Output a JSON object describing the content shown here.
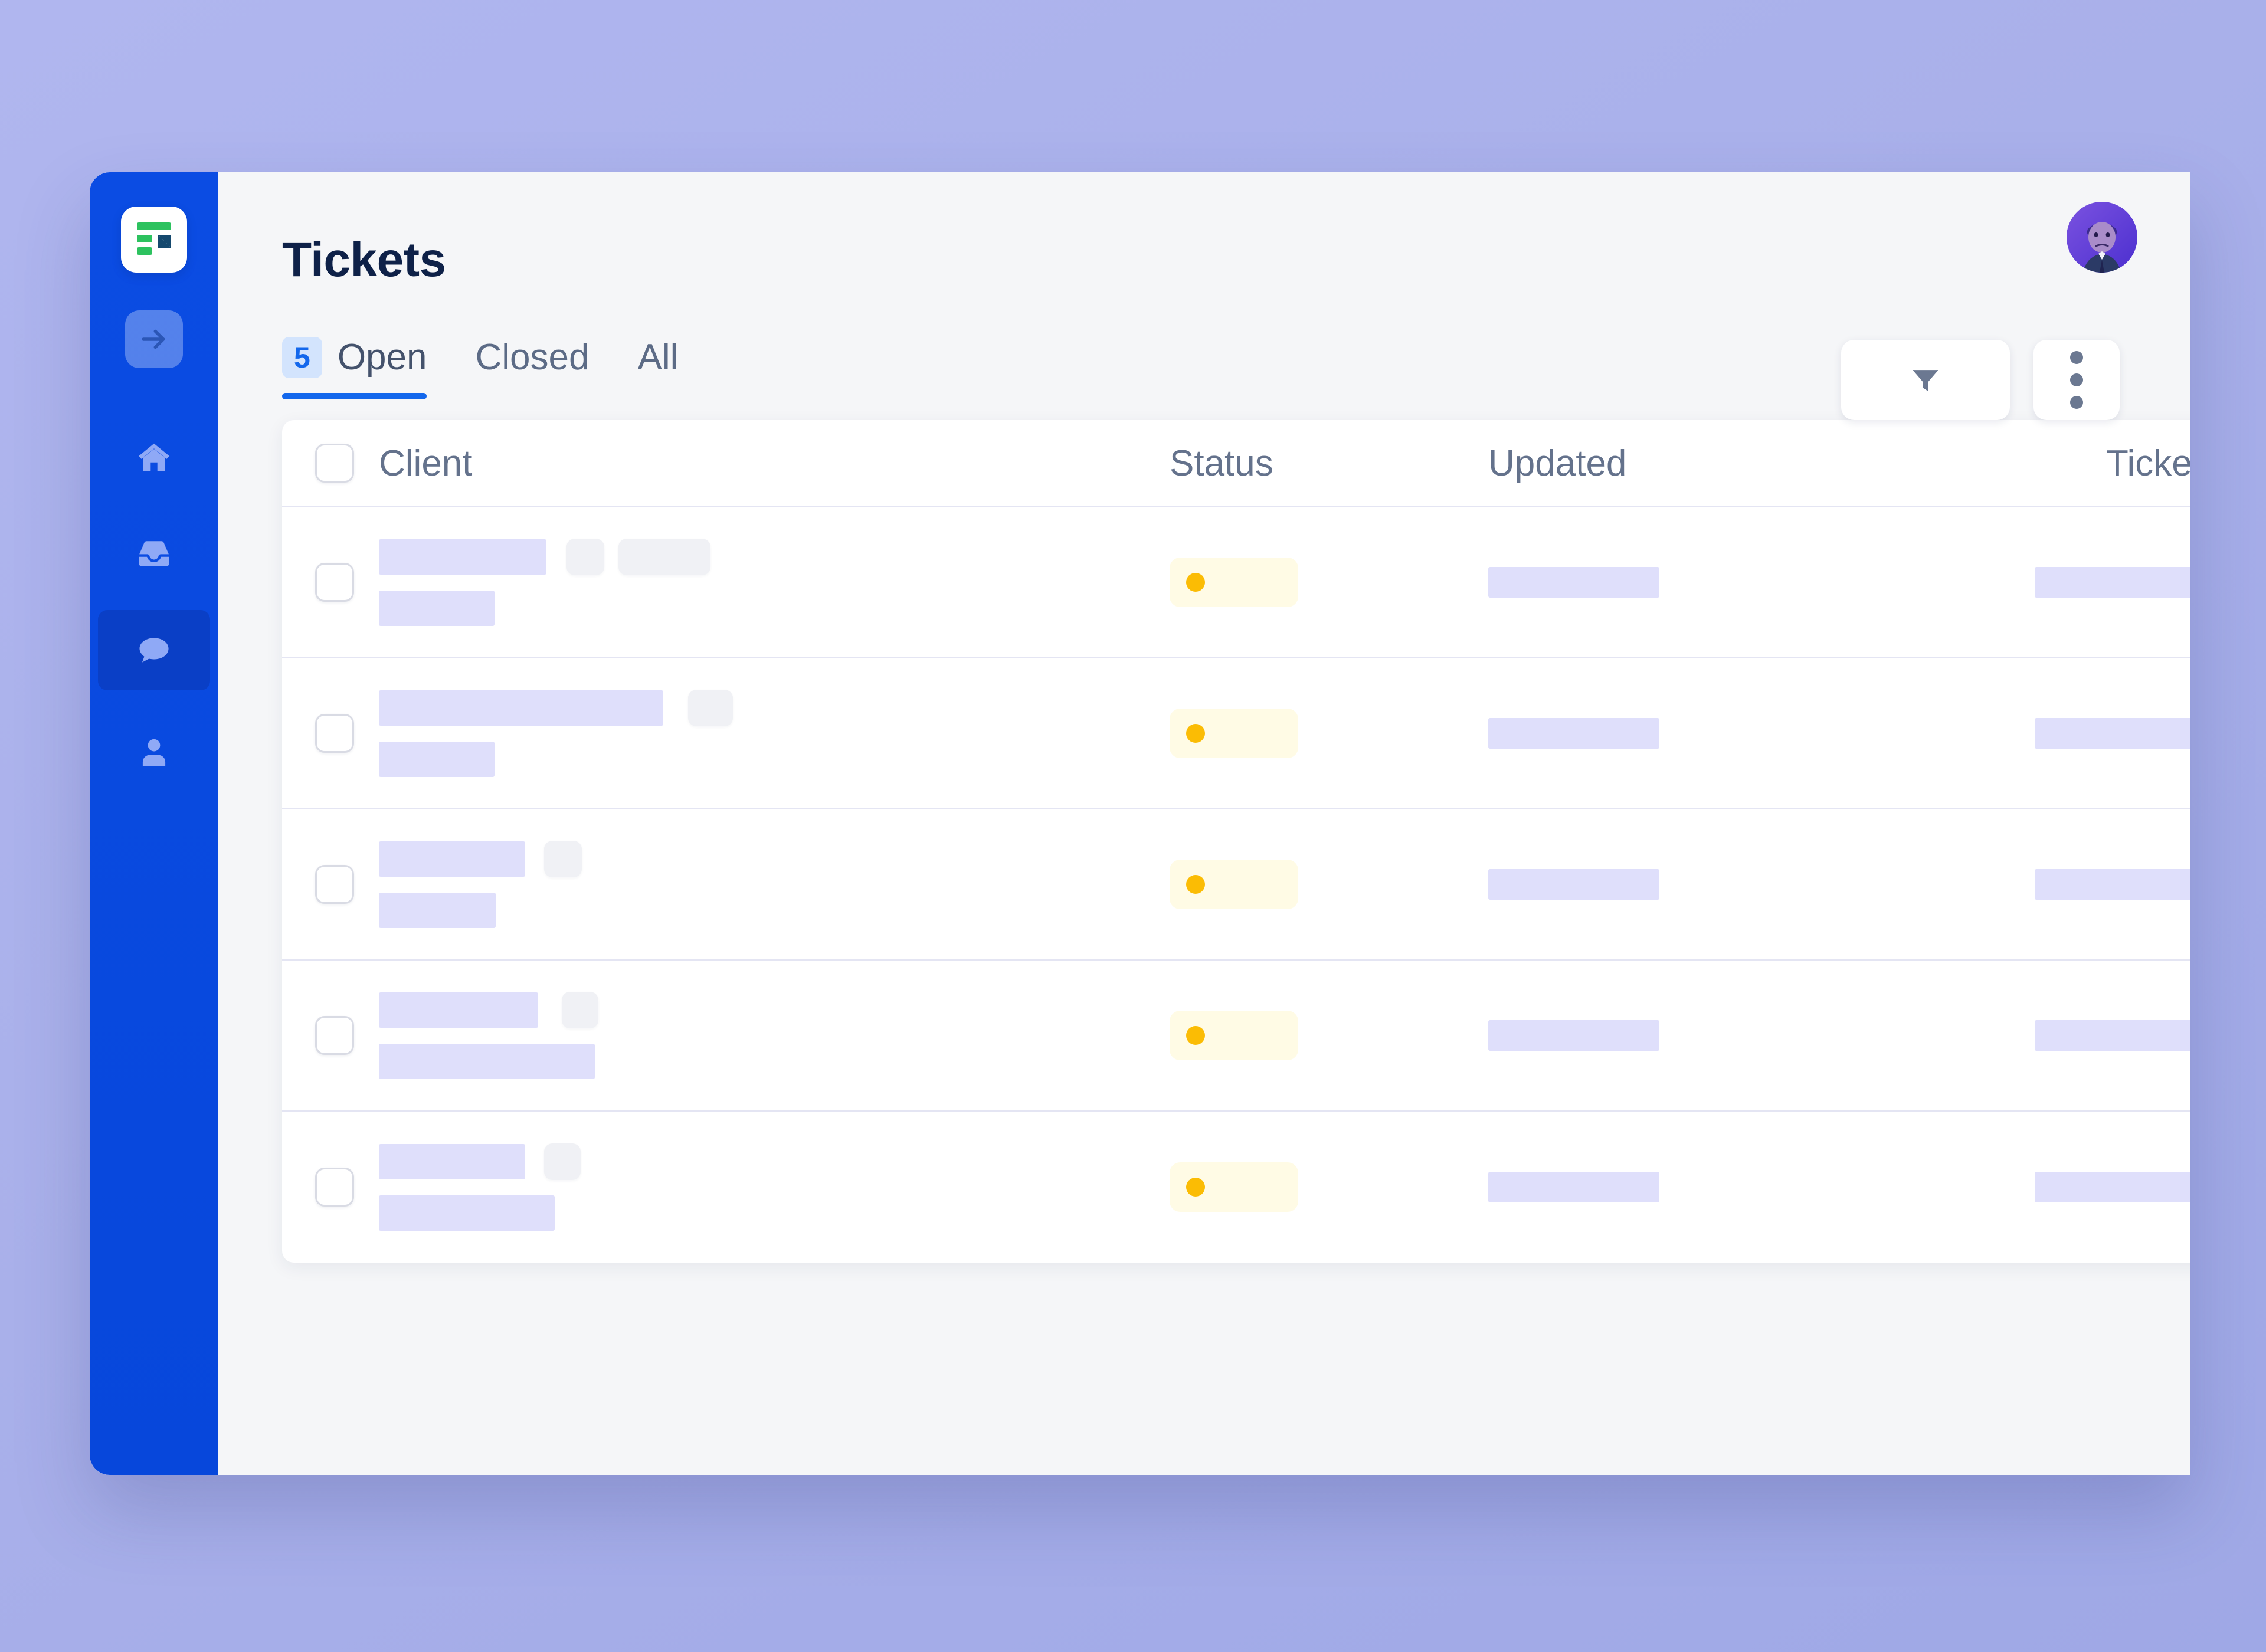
{
  "theme": {
    "page_background": "#a9b0ea",
    "sidebar_color": "#0a4de0",
    "sidebar_active_color": "#0a3fc6",
    "accent_color": "#1367ec",
    "title_color": "#0e2148",
    "muted_text_color": "#5c6b86",
    "card_background": "#ffffff",
    "app_background": "#f5f6f8",
    "skeleton_lavender": "#dfdffb",
    "skeleton_gray": "#f0f1f5",
    "status_pill_background": "#fffbe5",
    "status_dot_color": "#fbbc04",
    "badge_background": "#d3e4fd",
    "logo_green": "#2dc25f",
    "logo_navy": "#15496e"
  },
  "sidebar": {
    "logo": {
      "name": "app-logo",
      "icon": "document-list-logo"
    },
    "items": [
      {
        "name": "sidebar-item-expand",
        "icon": "arrow-right-icon",
        "active": false,
        "boxed": true
      },
      {
        "name": "sidebar-item-home",
        "icon": "home-icon",
        "active": false,
        "boxed": false
      },
      {
        "name": "sidebar-item-inbox",
        "icon": "inbox-icon",
        "active": false,
        "boxed": false
      },
      {
        "name": "sidebar-item-messages",
        "icon": "chat-bubble-icon",
        "active": true,
        "boxed": false
      },
      {
        "name": "sidebar-item-contacts",
        "icon": "person-icon",
        "active": false,
        "boxed": false
      }
    ]
  },
  "header": {
    "title": "Tickets",
    "avatar": {
      "name": "user-avatar",
      "icon": "user-photo-avatar"
    }
  },
  "tabs": [
    {
      "label": "Open",
      "badge": "5",
      "active": true
    },
    {
      "label": "Closed",
      "badge": null,
      "active": false
    },
    {
      "label": "All",
      "badge": null,
      "active": false
    }
  ],
  "toolbar": {
    "filter_button": {
      "label": "",
      "icon": "funnel-filter-icon"
    },
    "more_button": {
      "label": "",
      "icon": "more-vertical-icon"
    }
  },
  "table": {
    "columns": [
      {
        "key": "select",
        "label": ""
      },
      {
        "key": "client",
        "label": "Client"
      },
      {
        "key": "status",
        "label": "Status"
      },
      {
        "key": "updated",
        "label": "Updated"
      },
      {
        "key": "ticket",
        "label": "Ticket"
      }
    ],
    "rows": [
      {
        "client_primary_width": 284,
        "client_chips": [
          64,
          156
        ],
        "client_secondary_width": 196,
        "status": {
          "dot_color": "#fbbc04",
          "label": ""
        },
        "updated_width": 290,
        "ticket_width": 284
      },
      {
        "client_primary_width": 482,
        "client_chips": [
          76
        ],
        "client_secondary_width": 196,
        "status": {
          "dot_color": "#fbbc04",
          "label": ""
        },
        "updated_width": 290,
        "ticket_width": 284
      },
      {
        "client_primary_width": 248,
        "client_chips": [
          64
        ],
        "client_secondary_width": 198,
        "status": {
          "dot_color": "#fbbc04",
          "label": ""
        },
        "updated_width": 290,
        "ticket_width": 284
      },
      {
        "client_primary_width": 270,
        "client_chips": [
          62
        ],
        "client_secondary_width": 366,
        "status": {
          "dot_color": "#fbbc04",
          "label": ""
        },
        "updated_width": 290,
        "ticket_width": 284
      },
      {
        "client_primary_width": 248,
        "client_chips": [
          62
        ],
        "client_secondary_width": 298,
        "status": {
          "dot_color": "#fbbc04",
          "label": ""
        },
        "updated_width": 290,
        "ticket_width": 284
      }
    ]
  }
}
